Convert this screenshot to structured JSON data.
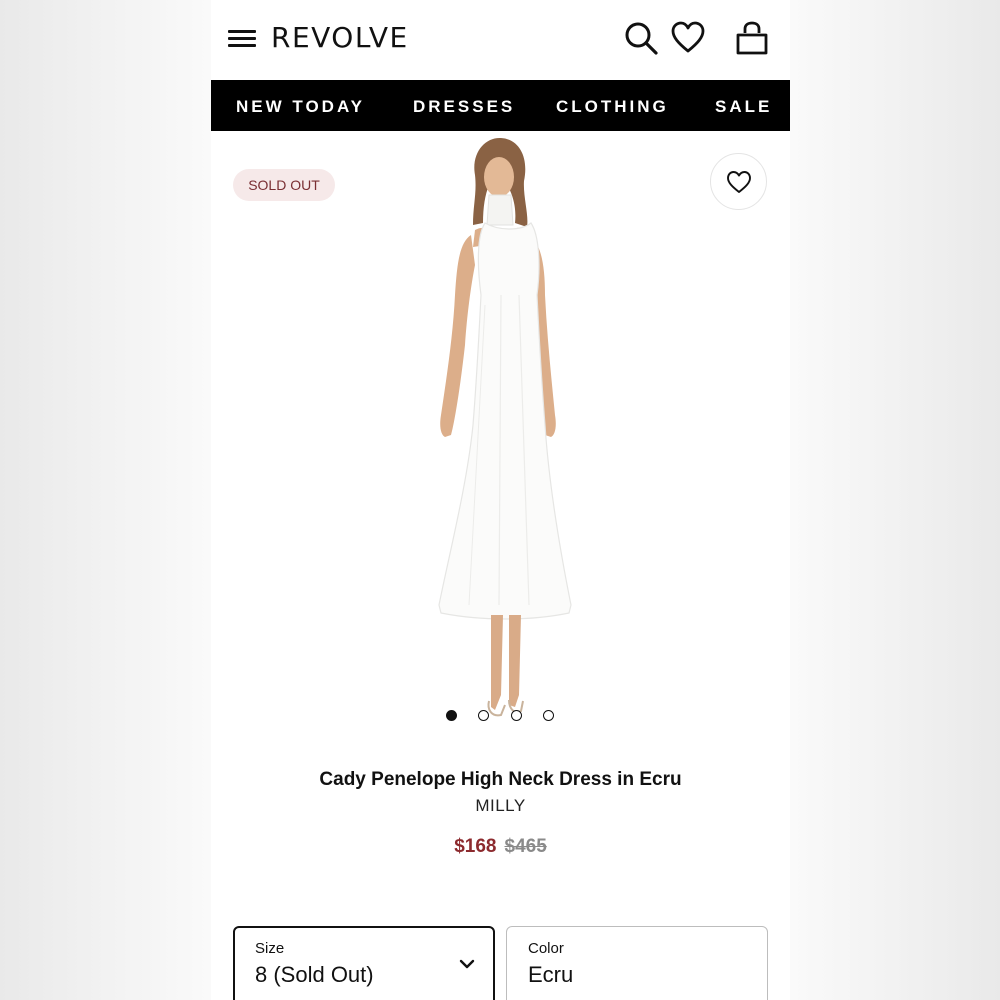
{
  "header": {
    "logo": "REVOLVE",
    "icons": [
      "menu-icon",
      "search-icon",
      "heart-icon",
      "shopping-bag-icon"
    ]
  },
  "nav": {
    "items": [
      {
        "label": "NEW TODAY"
      },
      {
        "label": "DRESSES"
      },
      {
        "label": "CLOTHING"
      },
      {
        "label": "SALE"
      }
    ]
  },
  "product": {
    "badge": "SOLD OUT",
    "title": "Cady Penelope High Neck Dress in Ecru",
    "brand": "MILLY",
    "price_sale": "$168",
    "price_original": "$465",
    "image_count": 4,
    "active_image": 1
  },
  "options": {
    "size": {
      "label": "Size",
      "value": "8 (Sold Out)"
    },
    "color": {
      "label": "Color",
      "value": "Ecru"
    }
  },
  "colors": {
    "nav_bg": "#000000",
    "sale_price": "#8c2a2e",
    "badge_bg": "#f6e9e9",
    "badge_text": "#7a2f33"
  }
}
